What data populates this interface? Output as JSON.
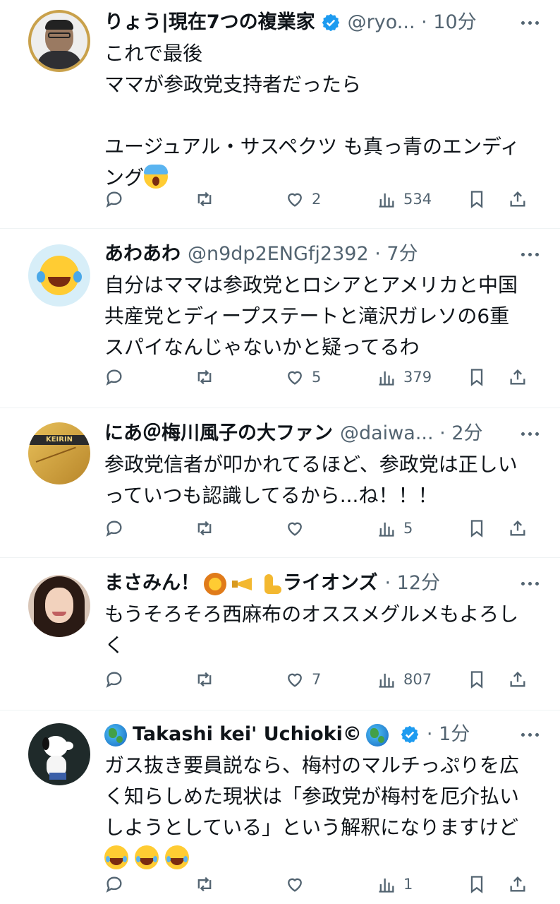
{
  "posts": [
    {
      "name": "りょう|現在7つの複業家",
      "verified": true,
      "handle": "@ryo...",
      "time": "10分",
      "lines": [
        "これで最後",
        "ママが参政党支持者だったら",
        "",
        "ユージュアル・サスペクツ も真っ青のエンディ",
        "ング"
      ],
      "trailing_emoji": "scream-emoji",
      "stats": {
        "replies": "",
        "reposts": "",
        "likes": "2",
        "views": "534"
      }
    },
    {
      "name": "あわあわ",
      "verified": false,
      "handle": "@n9dp2ENGfj2392",
      "time": "7分",
      "lines": [
        "自分はママは参政党とロシアとアメリカと中国",
        "共産党とディープステートと滝沢ガレソの6重",
        "スパイなんじゃないかと疑ってるわ"
      ],
      "stats": {
        "replies": "",
        "reposts": "",
        "likes": "5",
        "views": "379"
      }
    },
    {
      "name": "にあ＠梅川風子の大ファン",
      "verified": false,
      "handle": "@daiwa...",
      "time": "2分",
      "lines": [
        "参政党信者が叩かれてるほど、参政党は正しい",
        "っていつも認識してるから...ね！！！"
      ],
      "avatar_text": "KEIRIN",
      "stats": {
        "replies": "",
        "reposts": "",
        "likes": "",
        "views": "5"
      }
    },
    {
      "name_prefix": "まさみん！",
      "name_suffix": "ライオンズ",
      "verified": false,
      "time": "12分",
      "lines": [
        "もうそろそろ西麻布のオススメグルメもよろし",
        "く"
      ],
      "stats": {
        "replies": "",
        "reposts": "",
        "likes": "7",
        "views": "807"
      }
    },
    {
      "name": "Takashi kei' Uchioki©",
      "verified": true,
      "time": "1分",
      "lines": [
        "ガス抜き要員説なら、梅村のマルチっぷりを広",
        "く知らしめた現状は「参政党が梅村を厄介払い",
        "しようとしている」という解釈になりますけど"
      ],
      "trailing_emoji": "laugh-emoji x3",
      "stats": {
        "replies": "",
        "reposts": "",
        "likes": "",
        "views": "1"
      }
    }
  ],
  "icons": {
    "reply": "reply-icon",
    "repost": "repost-icon",
    "like": "heart-icon",
    "views": "views-icon",
    "bookmark": "bookmark-icon",
    "share": "share-icon",
    "more": "more-icon",
    "verified": "verified-badge-icon"
  },
  "colors": {
    "text": "#0f1419",
    "muted": "#536471",
    "verified": "#1d9bf0",
    "divider": "#eff3f4"
  }
}
